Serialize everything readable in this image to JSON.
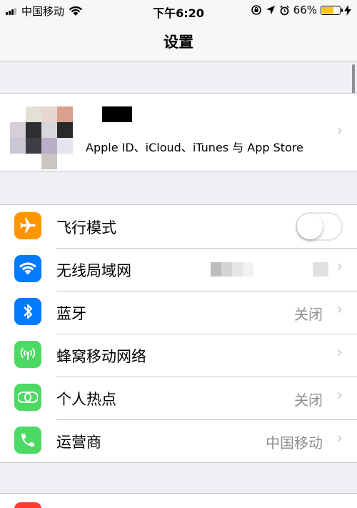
{
  "status_bar": {
    "carrier": "中国移动",
    "time": "下午6:20",
    "battery": "66%",
    "battery_level": 0.66,
    "wifi_icon": "wifi-icon",
    "battery_color": "#f6c90e"
  },
  "nav": {
    "title": "设置"
  },
  "profile": {
    "subtitle": "Apple ID、iCloud、iTunes 与 App Store"
  },
  "settings": {
    "airplane": {
      "label": "飞行模式",
      "icon": "airplane-icon",
      "color": "#ff9500",
      "toggle_on": false
    },
    "wifi": {
      "label": "无线局域网",
      "icon": "wifi-icon",
      "color": "#007aff"
    },
    "bluetooth": {
      "label": "蓝牙",
      "value": "关闭",
      "icon": "bluetooth-icon",
      "color": "#007aff"
    },
    "cellular": {
      "label": "蜂窝移动网络",
      "icon": "cellular-icon",
      "color": "#4cd964"
    },
    "hotspot": {
      "label": "个人热点",
      "value": "关闭",
      "icon": "hotspot-icon",
      "color": "#4cd964"
    },
    "carrier": {
      "label": "运营商",
      "value": "中国移动",
      "icon": "phone-icon",
      "color": "#4cd964"
    }
  }
}
